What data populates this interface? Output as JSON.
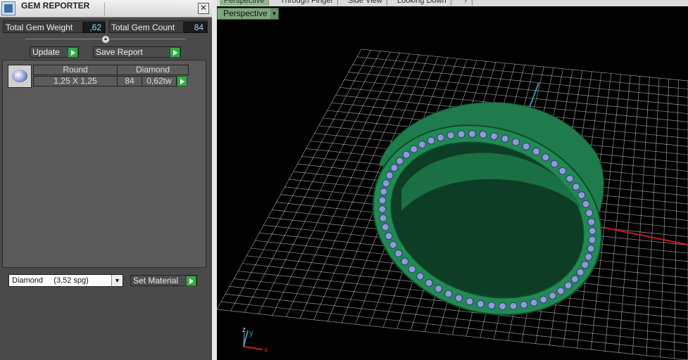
{
  "panel": {
    "title": "GEM REPORTER",
    "close_glyph": "✕",
    "total_weight_label": "Total Gem Weight",
    "total_weight_value": ",62",
    "total_count_label": "Total Gem Count",
    "total_count_value": "84",
    "update_label": "Update",
    "save_report_label": "Save Report",
    "gems": [
      {
        "shape": "Round",
        "material": "Diamond",
        "size": "1,25 X 1,25",
        "count": "84",
        "weight": "0,62tw"
      }
    ],
    "material_select": "Diamond     (3,52 spg)",
    "set_material_label": "Set Material"
  },
  "viewport": {
    "tabs": [
      "Perspective",
      "Through Finger",
      "Side View",
      "Looking Down",
      "?"
    ],
    "view_name": "Perspective",
    "axis_labels": {
      "x": "x",
      "y": "y",
      "z": "z"
    },
    "colors": {
      "ring": "#1f7a4c",
      "grid": "#cfcfcf",
      "x_axis": "#c81c1c",
      "y_axis": "#2a9ab8",
      "gem": "#8e9bd6"
    }
  },
  "icons": [
    "app-icon",
    "close-icon",
    "go-arrow-icon",
    "gem-thumbnail",
    "dropdown-arrow-icon"
  ]
}
